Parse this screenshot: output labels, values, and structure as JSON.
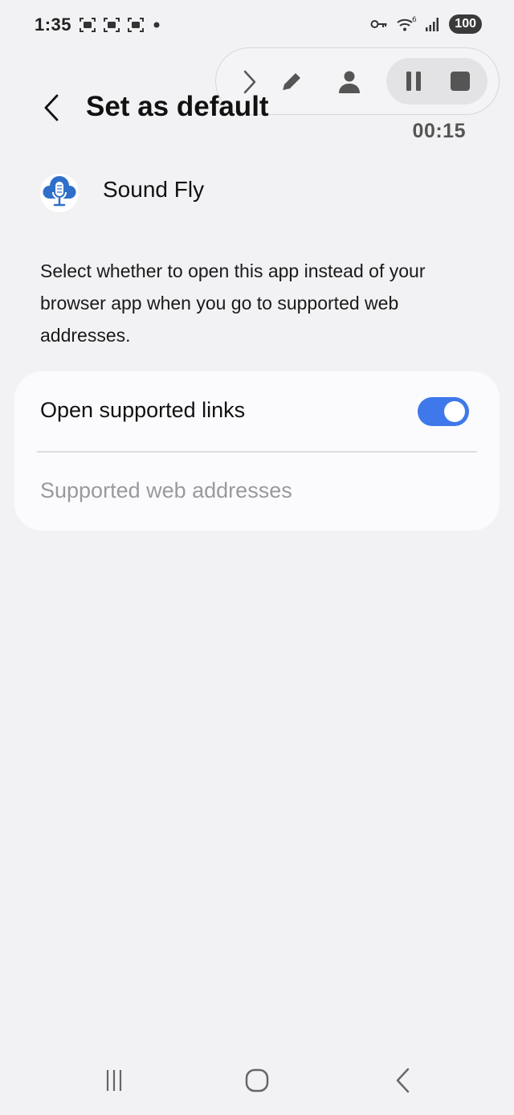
{
  "status_bar": {
    "time": "1:35",
    "battery": "100",
    "icons_left": [
      "screenshot-frame-icon",
      "screenshot-frame-icon",
      "screenshot-frame-icon",
      "dot-icon"
    ],
    "icons_right": [
      "key-icon",
      "wifi-6-icon",
      "signal-icon",
      "battery-icon"
    ]
  },
  "recorder": {
    "timer": "00:15",
    "controls": [
      "chevron-right-icon",
      "pen-icon",
      "person-icon",
      "pause-icon",
      "stop-icon"
    ]
  },
  "header": {
    "title": "Set as default"
  },
  "app": {
    "name": "Sound Fly",
    "icon": "microphone-cloud-icon"
  },
  "description": "Select whether to open this app instead of your browser app when you go to supported web addresses.",
  "settings": {
    "open_links_label": "Open supported links",
    "open_links_enabled": true,
    "web_addresses_label": "Supported web addresses"
  },
  "nav_bar": {
    "buttons": [
      "recents-icon",
      "home-icon",
      "back-icon"
    ]
  },
  "colors": {
    "background": "#f2f2f4",
    "card": "#fbfbfd",
    "accent": "#3e78ea",
    "disabled_text": "#9a9a9e"
  }
}
